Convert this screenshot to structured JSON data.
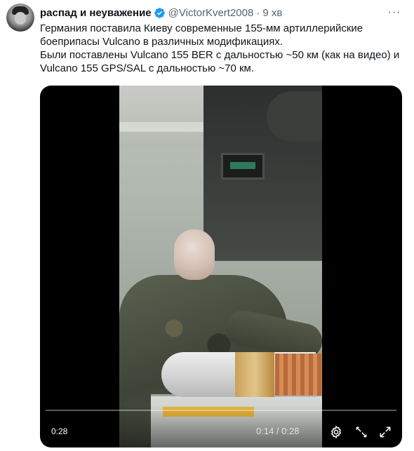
{
  "author": {
    "display_name": "распад и неуважение",
    "handle": "@VictorKvert2008",
    "separator": "·",
    "time": "9 хв",
    "verified": true
  },
  "more_label": "···",
  "tweet_text": [
    "Германия поставила Киеву современные 155-мм артиллерийские",
    "боеприпасы Vulcano в различных модификациях.",
    "Были поставлены Vulcano 155 BER с дальностью ~50 км (как на видео) и",
    "Vulcano 155 GPS/SAL с дальностью ~70 км."
  ],
  "video": {
    "duration": "0:28",
    "playback_time": "0:14 / 0:28",
    "progress_fraction": 0.0,
    "accent_color": "#1d9bf0"
  },
  "icons": {
    "verified": "verified-badge-icon",
    "settings": "gear-icon",
    "share": "share-icon",
    "fullscreen": "fullscreen-icon",
    "more": "more-dots-icon"
  }
}
